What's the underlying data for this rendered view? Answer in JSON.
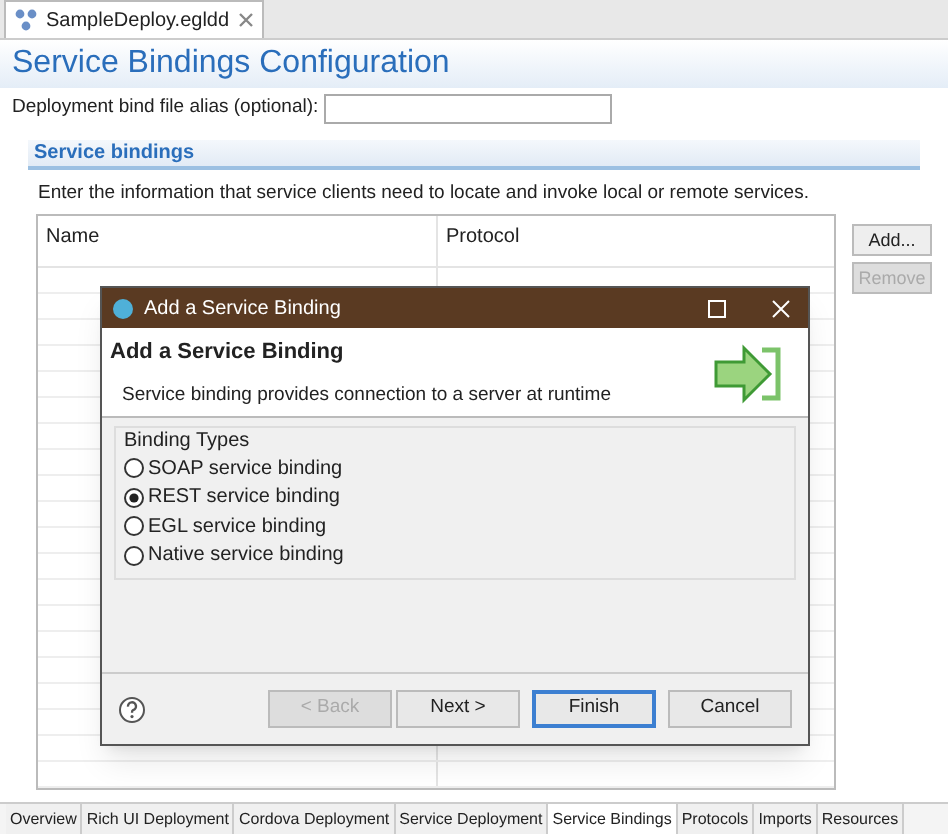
{
  "editor_tab": {
    "title": "SampleDeploy.egldd"
  },
  "page_title": "Service Bindings Configuration",
  "alias": {
    "label": "Deployment bind file alias (optional):"
  },
  "section": {
    "title": "Service bindings",
    "description": "Enter the information that service clients need to locate and invoke local or remote services."
  },
  "table": {
    "columns": [
      "Name",
      "Protocol"
    ]
  },
  "side_buttons": [
    {
      "label": "Add...",
      "disabled": false
    },
    {
      "label": "Remove",
      "disabled": true
    }
  ],
  "dialog": {
    "title": "Add a Service Binding",
    "heading": "Add a Service Binding",
    "description": "Service binding provides connection to a server at runtime",
    "group_label": "Binding Types",
    "options": [
      {
        "label": "SOAP service binding",
        "selected": false
      },
      {
        "label": "REST service binding",
        "selected": true
      },
      {
        "label": "EGL service binding",
        "selected": false
      },
      {
        "label": "Native service binding",
        "selected": false
      }
    ],
    "buttons": [
      {
        "label": "< Back",
        "disabled": true,
        "focused": false
      },
      {
        "label": "Next >",
        "disabled": false,
        "focused": false
      },
      {
        "label": "Finish",
        "disabled": false,
        "focused": true
      },
      {
        "label": "Cancel",
        "disabled": false,
        "focused": false
      }
    ]
  },
  "bottom_tabs": [
    {
      "label": "Overview",
      "selected": false
    },
    {
      "label": "Rich UI Deployment",
      "selected": false
    },
    {
      "label": "Cordova Deployment",
      "selected": false
    },
    {
      "label": "Service Deployment",
      "selected": false
    },
    {
      "label": "Service Bindings",
      "selected": true
    },
    {
      "label": "Protocols",
      "selected": false
    },
    {
      "label": "Imports",
      "selected": false
    },
    {
      "label": "Resources",
      "selected": false
    }
  ]
}
